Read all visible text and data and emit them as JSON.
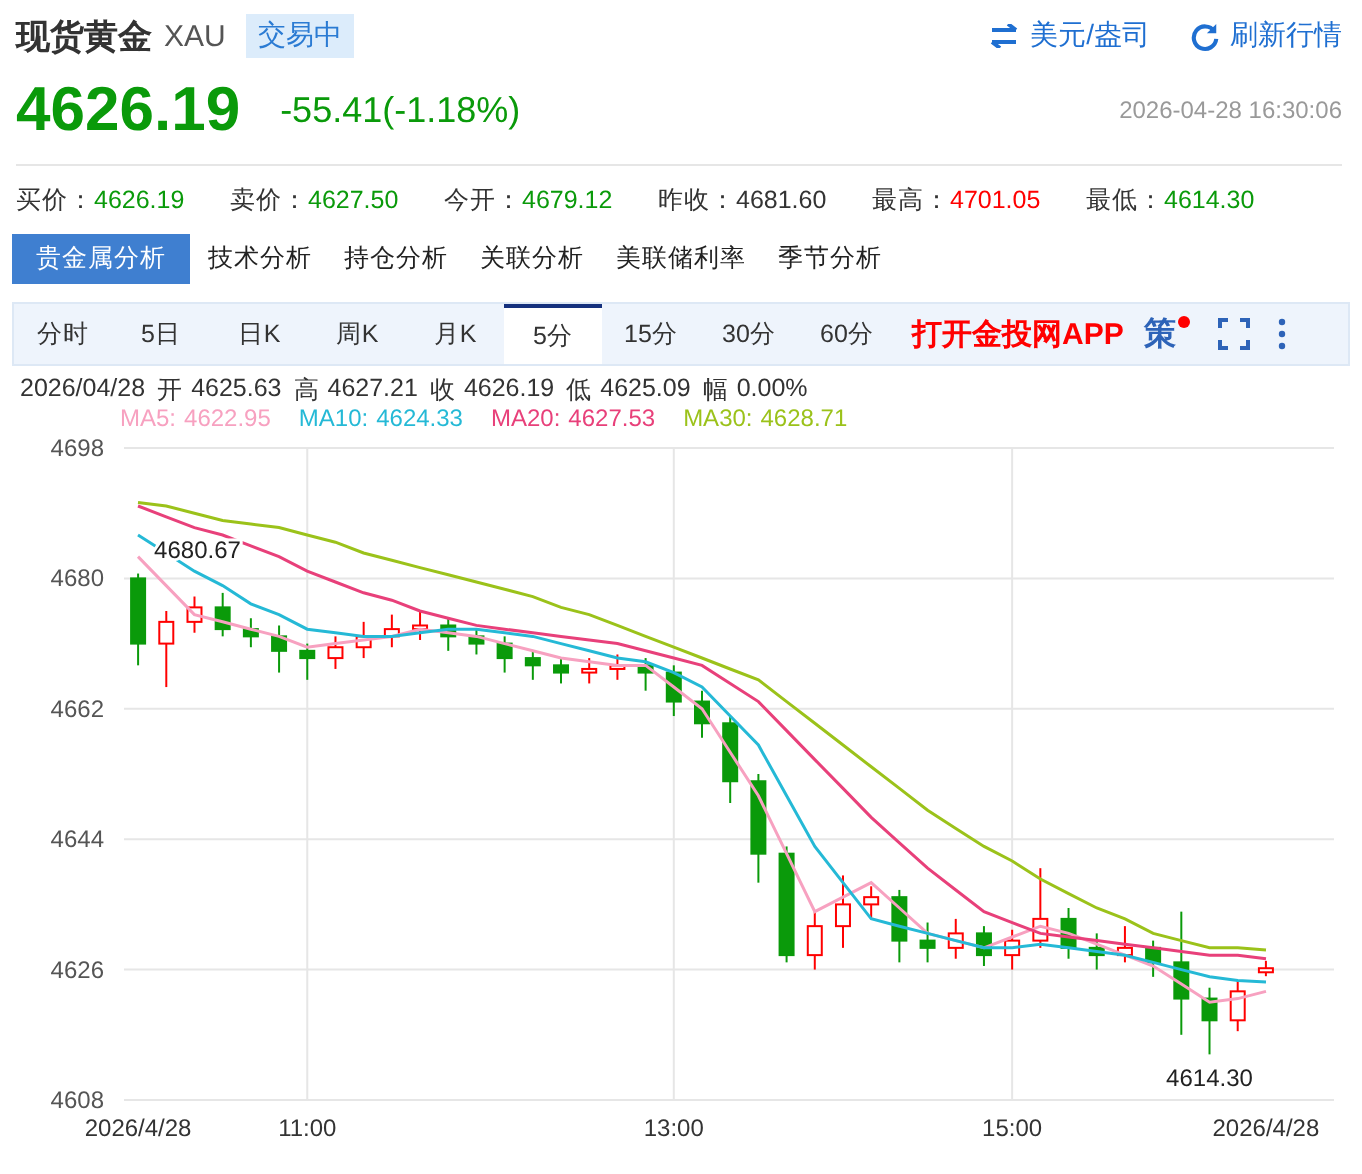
{
  "header": {
    "title": "现货黄金",
    "symbol": "XAU",
    "status": "交易中",
    "unit_link": "美元/盎司",
    "refresh_link": "刷新行情",
    "price": "4626.19",
    "change": "-55.41(-1.18%)",
    "timestamp": "2026-04-28 16:30:06"
  },
  "quotes": [
    {
      "label": "买价：",
      "value": "4626.19",
      "color": "#0a9a0a"
    },
    {
      "label": "卖价：",
      "value": "4627.50",
      "color": "#0a9a0a"
    },
    {
      "label": "今开：",
      "value": "4679.12",
      "color": "#0a9a0a"
    },
    {
      "label": "昨收：",
      "value": "4681.60",
      "color": "#333333"
    },
    {
      "label": "最高：",
      "value": "4701.05",
      "color": "#ff0000"
    },
    {
      "label": "最低：",
      "value": "4614.30",
      "color": "#0a9a0a"
    }
  ],
  "analysis_tabs": [
    {
      "label": "贵金属分析",
      "selected": true
    },
    {
      "label": "技术分析",
      "selected": false
    },
    {
      "label": "持仓分析",
      "selected": false
    },
    {
      "label": "关联分析",
      "selected": false
    },
    {
      "label": "美联储利率",
      "selected": false
    },
    {
      "label": "季节分析",
      "selected": false
    }
  ],
  "period_tabs": [
    {
      "label": "分时",
      "selected": false
    },
    {
      "label": "5日",
      "selected": false
    },
    {
      "label": "日K",
      "selected": false
    },
    {
      "label": "周K",
      "selected": false
    },
    {
      "label": "月K",
      "selected": false
    },
    {
      "label": "5分",
      "selected": true
    },
    {
      "label": "15分",
      "selected": false
    },
    {
      "label": "30分",
      "selected": false
    },
    {
      "label": "60分",
      "selected": false
    }
  ],
  "app_link": "打开金投网APP",
  "strategy": {
    "label": "策",
    "notification": true
  },
  "bar_info": [
    {
      "label": "2026/04/28"
    },
    {
      "label": "开",
      "value": "4625.63"
    },
    {
      "label": "高",
      "value": "4627.21"
    },
    {
      "label": "收",
      "value": "4626.19"
    },
    {
      "label": "低",
      "value": "4625.09"
    },
    {
      "label": "幅",
      "value": "0.00%"
    }
  ],
  "legend": [
    {
      "value": "4622.95"
    },
    {
      "value": "4624.33"
    },
    {
      "value": "4627.53"
    },
    {
      "value": "4628.71"
    }
  ],
  "chart_data": {
    "type": "candlestick",
    "grid": true,
    "ylim": [
      4608,
      4698
    ],
    "yticks": [
      4608,
      4626,
      4644,
      4662,
      4680,
      4698
    ],
    "categories": [
      "2026/4/28",
      null,
      null,
      null,
      null,
      null,
      "11:00",
      null,
      null,
      null,
      null,
      null,
      null,
      null,
      null,
      null,
      null,
      null,
      null,
      "13:00",
      null,
      null,
      null,
      null,
      null,
      null,
      null,
      null,
      null,
      null,
      null,
      "15:00",
      null,
      null,
      null,
      null,
      null,
      null,
      null,
      null,
      "2026/4/28"
    ],
    "ohlc": [
      [
        4680,
        4680.67,
        4668,
        4671
      ],
      [
        4671,
        4675.5,
        4665,
        4674
      ],
      [
        4674,
        4677.5,
        4672.5,
        4676
      ],
      [
        4676,
        4678,
        4672,
        4673
      ],
      [
        4673,
        4674.5,
        4670.5,
        4672
      ],
      [
        4672,
        4673.5,
        4667,
        4670
      ],
      [
        4670,
        4671,
        4666,
        4669
      ],
      [
        4669,
        4672,
        4667.5,
        4670.5
      ],
      [
        4670.5,
        4674,
        4669,
        4672
      ],
      [
        4672,
        4675,
        4670.5,
        4673
      ],
      [
        4673,
        4675.5,
        4671.5,
        4673.5
      ],
      [
        4673.5,
        4674.5,
        4670,
        4672
      ],
      [
        4672,
        4673,
        4669.5,
        4671
      ],
      [
        4671,
        4672,
        4667,
        4669
      ],
      [
        4669,
        4670,
        4666,
        4668
      ],
      [
        4668,
        4669,
        4665.5,
        4667
      ],
      [
        4667,
        4669,
        4665.5,
        4667.5
      ],
      [
        4667.5,
        4669.5,
        4666,
        4668
      ],
      [
        4668,
        4669,
        4664.5,
        4667
      ],
      [
        4667,
        4668,
        4661,
        4663
      ],
      [
        4663,
        4664.5,
        4658,
        4660
      ],
      [
        4660,
        4661,
        4649,
        4652
      ],
      [
        4652,
        4653,
        4638,
        4642
      ],
      [
        4642,
        4643,
        4627,
        4628
      ],
      [
        4628,
        4634,
        4626,
        4632
      ],
      [
        4632,
        4639,
        4629,
        4635
      ],
      [
        4635,
        4637.5,
        4633,
        4636
      ],
      [
        4636,
        4637,
        4627,
        4630
      ],
      [
        4630,
        4632.5,
        4627,
        4629
      ],
      [
        4629,
        4633,
        4627.5,
        4631
      ],
      [
        4631,
        4632,
        4626.5,
        4628
      ],
      [
        4628,
        4631.5,
        4626,
        4630
      ],
      [
        4630,
        4640,
        4629,
        4633
      ],
      [
        4633,
        4634.5,
        4627.5,
        4629
      ],
      [
        4629,
        4631,
        4626,
        4628
      ],
      [
        4628,
        4632,
        4627,
        4629
      ],
      [
        4629,
        4630,
        4625,
        4627
      ],
      [
        4627,
        4634,
        4617,
        4622
      ],
      [
        4622,
        4623.5,
        4614.3,
        4619
      ],
      [
        4619,
        4624.5,
        4617.5,
        4623
      ],
      [
        4625.63,
        4627.21,
        4625.09,
        4626.19
      ]
    ],
    "series": [
      {
        "name": "MA5:",
        "type": "line",
        "color": "#f7a1c0",
        "values": [
          4683,
          4679,
          4675,
          4674,
          4673,
          4672,
          4670.5,
          4671,
          4671.5,
          4672,
          4673,
          4672.5,
          4672,
          4671,
          4670,
          4669,
          4668.5,
          4668,
          4668,
          4665,
          4662,
          4656,
          4650,
          4642,
          4634,
          4636,
          4638,
          4634.5,
          4631,
          4630,
          4629,
          4630.5,
          4632,
          4631,
          4629.5,
          4628,
          4626.5,
          4624,
          4621.5,
          4622,
          4623
        ]
      },
      {
        "name": "MA10:",
        "type": "line",
        "color": "#25b9d6",
        "values": [
          4686,
          4683.5,
          4681,
          4679,
          4676.5,
          4675,
          4673,
          4672.5,
          4672,
          4672,
          4672.5,
          4673,
          4673,
          4672.5,
          4672,
          4671,
          4670,
          4669,
          4668.5,
          4667,
          4665,
          4661,
          4657,
          4650,
          4643,
          4638,
          4633,
          4632,
          4631,
          4630,
          4629,
          4629,
          4629.5,
          4629,
          4628.5,
          4628,
          4627,
          4626,
          4625,
          4624.5,
          4624.3
        ]
      },
      {
        "name": "MA20:",
        "type": "line",
        "color": "#e8407a",
        "values": [
          4690,
          4688.5,
          4687,
          4686,
          4684.5,
          4683,
          4681,
          4679.5,
          4678,
          4677,
          4675.5,
          4674.5,
          4673.5,
          4673,
          4672.5,
          4672,
          4671.5,
          4671,
          4670,
          4669,
          4668,
          4665.5,
          4663,
          4659,
          4655,
          4651,
          4647,
          4643.5,
          4640,
          4637,
          4634,
          4632.5,
          4631,
          4630.5,
          4630,
          4629.5,
          4629,
          4628.5,
          4628,
          4628,
          4627.5
        ]
      },
      {
        "name": "MA30:",
        "type": "line",
        "color": "#9bc21a",
        "values": [
          4690.5,
          4690,
          4689,
          4688,
          4687.5,
          4687,
          4686,
          4685,
          4683.5,
          4682.5,
          4681.5,
          4680.5,
          4679.5,
          4678.5,
          4677.5,
          4676,
          4675,
          4673.5,
          4672,
          4670.5,
          4669,
          4667.5,
          4666,
          4663,
          4660,
          4657,
          4654,
          4651,
          4648,
          4645.5,
          4643,
          4641,
          4638.5,
          4636.5,
          4634.5,
          4633,
          4631,
          4630,
          4629,
          4629,
          4628.7
        ]
      }
    ],
    "annotations": [
      "4680.67",
      "4614.30"
    ]
  }
}
